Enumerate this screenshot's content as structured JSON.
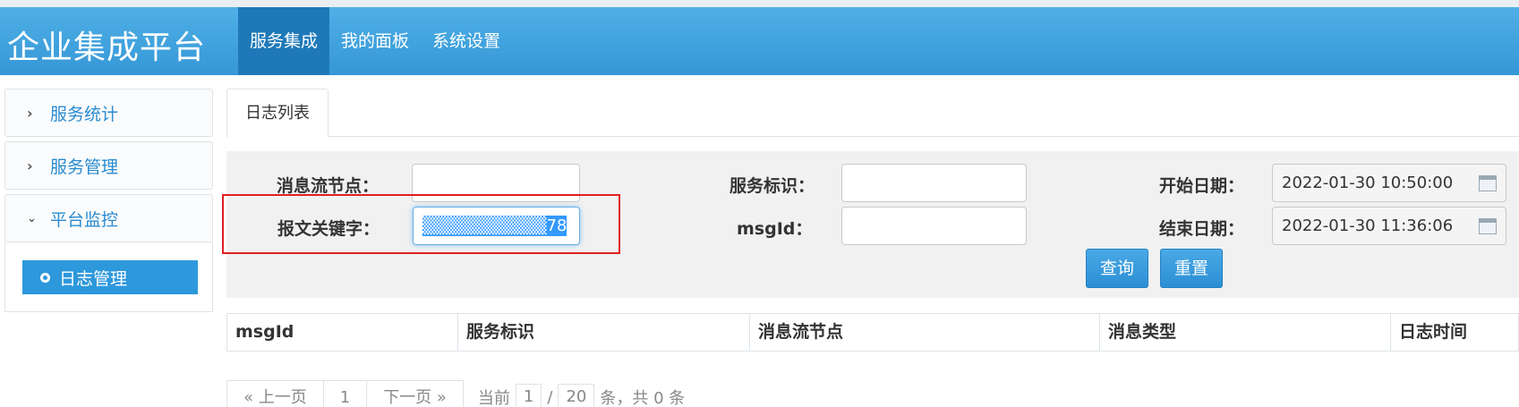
{
  "header": {
    "brand": "企业集成平台",
    "nav": [
      "服务集成",
      "我的面板",
      "系统设置"
    ],
    "active_nav": "服务集成"
  },
  "sidebar": {
    "items": [
      {
        "label": "服务统计",
        "icon": "chevron-right-icon"
      },
      {
        "label": "服务管理",
        "icon": "chevron-right-icon"
      },
      {
        "label": "平台监控",
        "icon": "chevron-down-icon"
      }
    ],
    "sub_items": [
      {
        "label": "日志管理",
        "icon": "circle-dot-icon"
      }
    ]
  },
  "tabs": [
    "日志列表"
  ],
  "search": {
    "node_label": "消息流节点：",
    "node_value": "",
    "keyword_label": "报文关键字：",
    "keyword_value_suffix": "78",
    "service_label": "服务标识：",
    "service_value": "",
    "msgid_label": "msgId：",
    "msgid_value": "",
    "start_label": "开始日期：",
    "start_value": "2022-01-30 10:50:00",
    "end_label": "结束日期：",
    "end_value": "2022-01-30 11:36:06",
    "query_button": "查询",
    "reset_button": "重置"
  },
  "table": {
    "columns": [
      "msgId",
      "服务标识",
      "消息流节点",
      "消息类型",
      "日志时间"
    ],
    "rows": []
  },
  "pagination": {
    "prev": "« 上一页",
    "page": "1",
    "next": "下一页 »",
    "current_label": "当前",
    "current_page": "1",
    "separator": "/",
    "total_pages": "20",
    "summary": "条，共 0 条"
  },
  "colors": {
    "header": "#3597d6",
    "active_nav": "#1f79b8",
    "accent": "#2d98dc",
    "highlight_border": "#e02020"
  }
}
